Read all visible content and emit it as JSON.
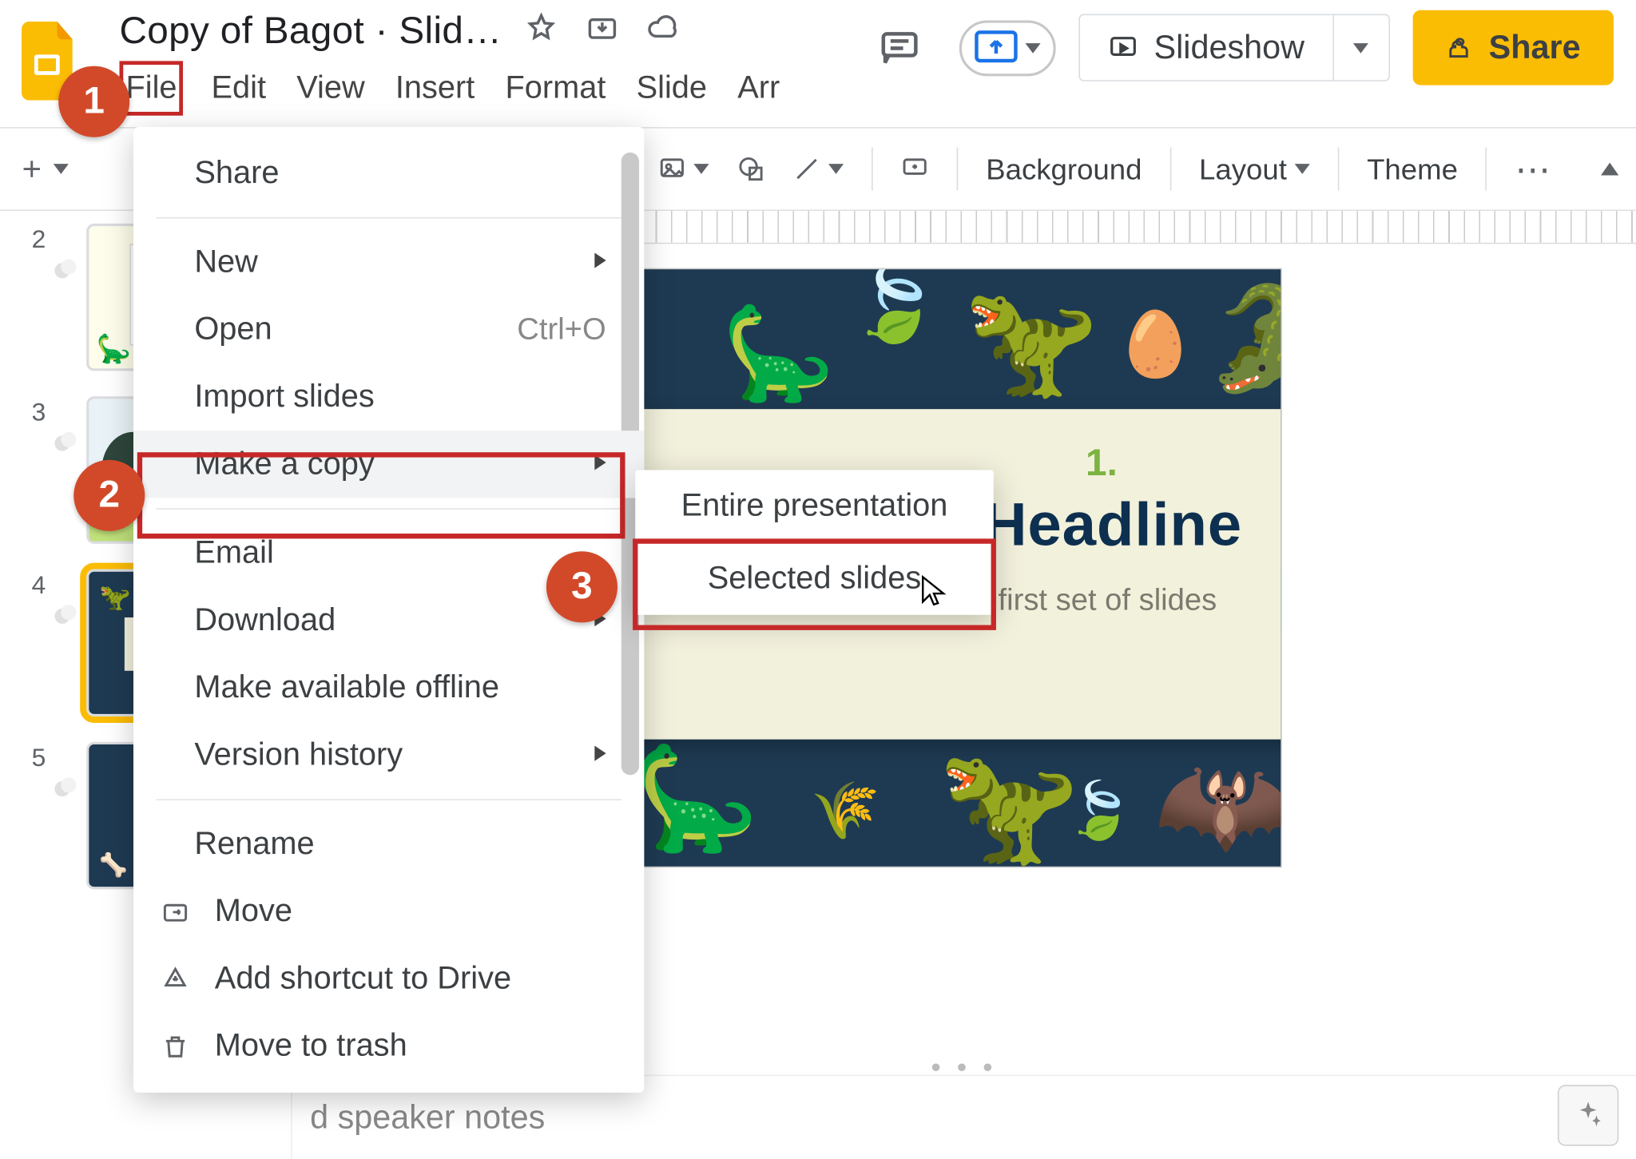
{
  "header": {
    "doc_title": "Copy of Bagot · Slid…",
    "slideshow_label": "Slideshow",
    "share_label": "Share"
  },
  "menubar": {
    "file": "File",
    "edit": "Edit",
    "view": "View",
    "insert": "Insert",
    "format": "Format",
    "slide": "Slide",
    "arrange": "Arr"
  },
  "toolbar": {
    "background": "Background",
    "layout": "Layout",
    "theme": "Theme"
  },
  "dropdown": {
    "share": "Share",
    "new": "New",
    "open": "Open",
    "open_shortcut": "Ctrl+O",
    "import": "Import slides",
    "make_copy": "Make a copy",
    "email": "Email",
    "download": "Download",
    "offline": "Make available offline",
    "history": "Version history",
    "rename": "Rename",
    "move": "Move",
    "shortcut_drive": "Add shortcut to Drive",
    "trash": "Move to trash"
  },
  "submenu": {
    "entire": "Entire presentation",
    "selected": "Selected slides"
  },
  "thumbs": {
    "n2": "2",
    "n3": "3",
    "n4": "4",
    "n5": "5"
  },
  "slide": {
    "kicker": "1.",
    "headline": "ion Headline",
    "subtitle": "Let's start with the first set of slides"
  },
  "notes": {
    "placeholder": "d speaker notes"
  },
  "badges": {
    "b1": "1",
    "b2": "2",
    "b3": "3"
  },
  "colors": {
    "accent_yellow": "#fbbc04",
    "accent_red": "#d2492a",
    "highlight_border": "#c62828",
    "slide_bg": "#1e3a52",
    "slide_panel": "#f2f1dc"
  }
}
